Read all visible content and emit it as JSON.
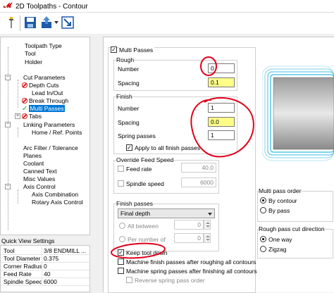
{
  "window": {
    "title": "2D Toolpaths - Contour"
  },
  "toolbar": {
    "icons": [
      "wrench-icon",
      "save-icon",
      "export-icon",
      "arrow-icon"
    ]
  },
  "tree": {
    "items": [
      {
        "label": "Toolpath Type"
      },
      {
        "label": "Tool"
      },
      {
        "label": "Holder"
      },
      {
        "label": "Cut Parameters"
      },
      {
        "label": "Depth Cuts"
      },
      {
        "label": "Lead In/Out"
      },
      {
        "label": "Break Through"
      },
      {
        "label": "Multi Passes"
      },
      {
        "label": "Tabs"
      },
      {
        "label": "Linking Parameters"
      },
      {
        "label": "Home / Ref. Points"
      },
      {
        "label": "Arc Filter / Tolerance"
      },
      {
        "label": "Planes"
      },
      {
        "label": "Coolant"
      },
      {
        "label": "Canned Text"
      },
      {
        "label": "Misc Values"
      },
      {
        "label": "Axis Control"
      },
      {
        "label": "Axis Combination"
      },
      {
        "label": "Rotary Axis Control"
      }
    ]
  },
  "quick_view": {
    "title": "Quick View Settings",
    "rows": [
      {
        "key": "Tool",
        "value": "3/8 ENDMILL ..."
      },
      {
        "key": "Tool Diameter",
        "value": "0.375"
      },
      {
        "key": "Corner Radius",
        "value": "0"
      },
      {
        "key": "Feed Rate",
        "value": "40"
      },
      {
        "key": "Spindle Speed",
        "value": "6000"
      }
    ]
  },
  "multi_passes": {
    "label": "Multi Passes",
    "checked": true,
    "rough": {
      "title": "Rough",
      "number_label": "Number",
      "number_value": "0",
      "spacing_label": "Spacing",
      "spacing_value": "0.1"
    },
    "finish": {
      "title": "Finish",
      "number_label": "Number",
      "number_value": "1",
      "spacing_label": "Spacing",
      "spacing_value": "0.0",
      "spring_label": "Spring passes",
      "spring_value": "1",
      "apply_label": "Apply to all finish passes"
    },
    "override": {
      "title": "Override Feed Speed",
      "feed_label": "Feed rate",
      "feed_value": "40.0",
      "spindle_label": "Spindle speed",
      "spindle_value": "6000"
    },
    "finish_passes": {
      "title": "Finish passes",
      "select_value": "Final depth",
      "all_between_label": "All between",
      "all_between_value": "0",
      "per_number_label": "Per number of",
      "per_number_value": "0",
      "keep_tool_label": "Keep tool down",
      "machine_finish_label": "Machine finish passes after roughing all contours",
      "machine_spring_label": "Machine spring passes after finishing all contours",
      "reverse_label": "Reverse spring pass order"
    },
    "order": {
      "title": "Multi pass order",
      "by_contour": "By contour",
      "by_pass": "By pass"
    },
    "rough_cut": {
      "title": "Rough pass cut direction",
      "one_way": "One way",
      "zigzag": "Zigzag"
    }
  },
  "colors": {
    "accent": "#0078d7",
    "highlight_yellow": "#ffff88",
    "annotation_red": "#e0001b"
  }
}
